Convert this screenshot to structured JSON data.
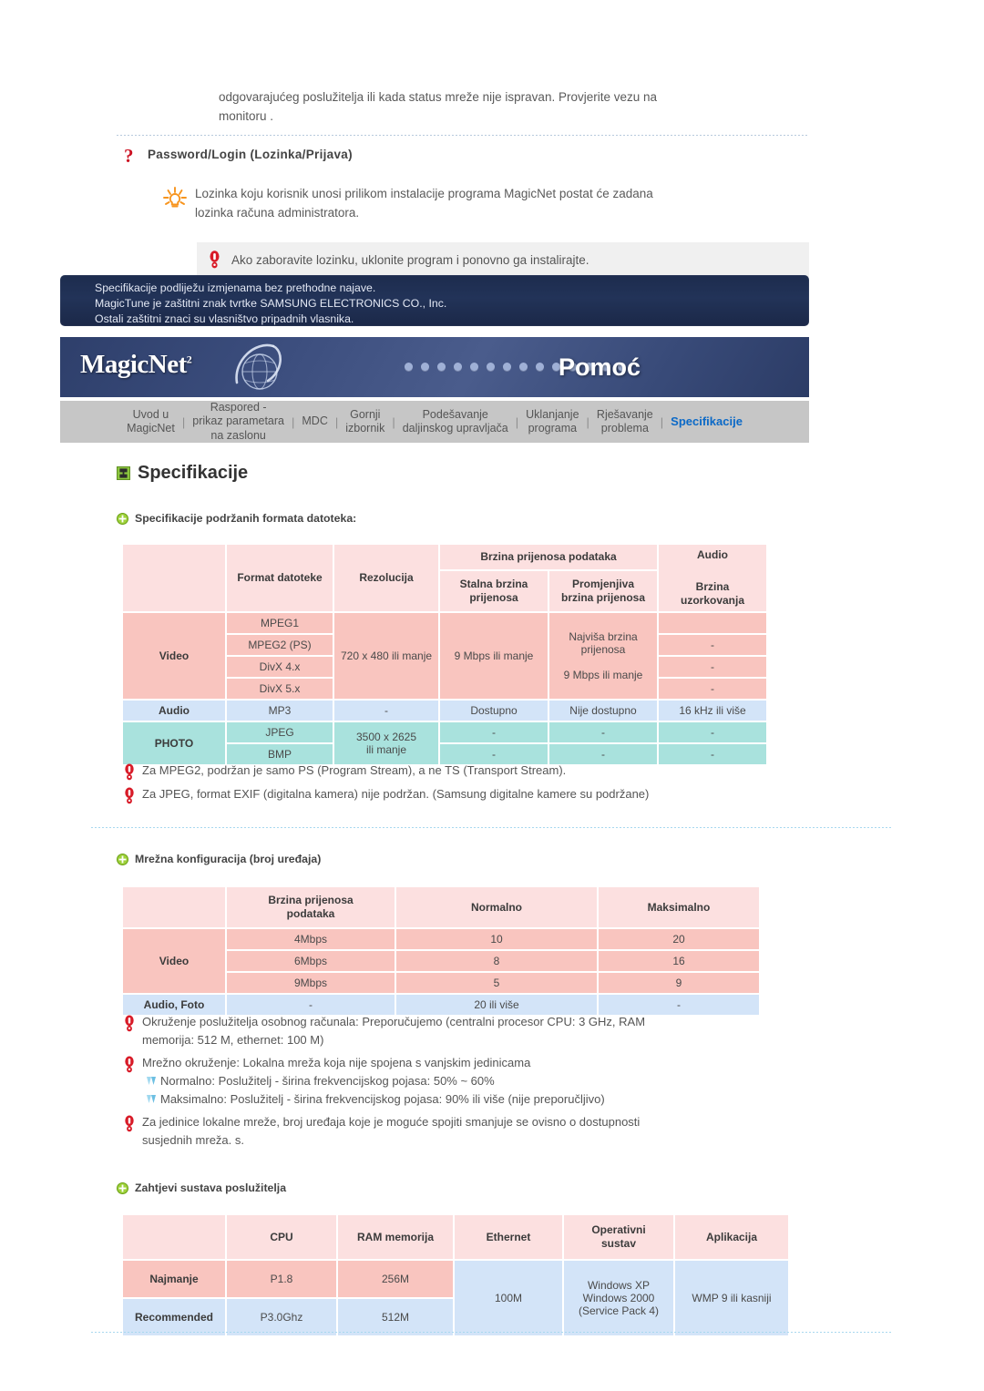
{
  "top": {
    "intro_line1": "odgovarajućeg poslužitelja ili kada status mreže nije ispravan. Provjerite vezu na",
    "intro_line2": "monitoru .",
    "question_title": "Password/Login (Lozinka/Prijava)",
    "tip_line1": "Lozinka koju korisnik unosi prilikom instalacije programa MagicNet postat će zadana",
    "tip_line2": "lozinka računa administratora.",
    "warning": "Ako zaboravite lozinku, uklonite program i ponovno ga instalirajte."
  },
  "navy_notice": {
    "line1": "Specifikacije podliježu izmjenama bez prethodne najave.",
    "line2": "MagicTune je zaštitni znak tvrtke SAMSUNG ELECTRONICS CO., Inc.",
    "line3": "Ostali zaštitni znaci su vlasništvo pripadnih vlasnika."
  },
  "header": {
    "logo": "MagicNet",
    "logo_sup": "2",
    "title": "Pomoć",
    "dot_count": 14
  },
  "nav": {
    "items": [
      {
        "label": "Uvod u\nMagicNet",
        "active": false
      },
      {
        "label": "Raspored -\nprikaz parametara\nna zaslonu",
        "active": false
      },
      {
        "label": "MDC",
        "active": false
      },
      {
        "label": "Gornji\nizbornik",
        "active": false
      },
      {
        "label": "Podešavanje\ndaljinskog upravljača",
        "active": false
      },
      {
        "label": "Uklanjanje\nprograma",
        "active": false
      },
      {
        "label": "Rješavanje\nproblema",
        "active": false
      },
      {
        "label": "Specifikacije",
        "active": true
      }
    ],
    "separator": "|"
  },
  "page_title": "Specifikacije",
  "sections": {
    "s1_heading": "Specifikacije podržanih formata datoteka:",
    "s2_heading": "Mrežna konfiguracija (broj uređaja)",
    "s3_heading": "Zahtjevi sustava poslužitelja"
  },
  "table1": {
    "h_format": "Format datoteke",
    "h_rezolucija": "Rezolucija",
    "h_brzina_group": "Brzina prijenosa podataka",
    "h_audio_group": "Audio",
    "h_stalna": "Stalna brzina\nprijenosa",
    "h_promjenjiva": "Promjenjiva\nbrzina prijenosa",
    "h_uzorkovanja": "Brzina\nuzorkovanja",
    "video_label": "Video",
    "video_formats": [
      "MPEG1",
      "MPEG2 (PS)",
      "DivX 4.x",
      "DivX 5.x"
    ],
    "video_rezolucija": "720 x 480 ili manje",
    "video_stalna": "9 Mbps ili manje",
    "video_promjenjiva_top": "Najviša brzina\nprijenosa",
    "video_promjenjiva_bottom": "9 Mbps ili manje",
    "video_uzorkovanja": [
      "",
      "-",
      "-",
      "-"
    ],
    "audio_label": "Audio",
    "audio_format": "MP3",
    "audio_rezolucija": "-",
    "audio_stalna": "Dostupno",
    "audio_promjenjiva": "Nije dostupno",
    "audio_uzorkovanja": "16 kHz ili više",
    "photo_label": "PHOTO",
    "photo_formats": [
      "JPEG",
      "BMP"
    ],
    "photo_rezolucija": "3500 x 2625\nili manje",
    "photo_dash": "-"
  },
  "notes1": [
    "Za MPEG2, podržan je samo PS (Program Stream), a ne TS (Transport Stream).",
    "Za JPEG, format EXIF (digitalna kamera) nije podržan. (Samsung digitalne kamere su podržane)"
  ],
  "table2": {
    "h_brzina": "Brzina prijenosa\npodataka",
    "h_normalno": "Normalno",
    "h_maksimalno": "Maksimalno",
    "video_label": "Video",
    "rows": [
      {
        "rate": "4Mbps",
        "normal": "10",
        "max": "20"
      },
      {
        "rate": "6Mbps",
        "normal": "8",
        "max": "16"
      },
      {
        "rate": "9Mbps",
        "normal": "5",
        "max": "9"
      }
    ],
    "audio_label": "Audio, Foto",
    "audio_rate": "-",
    "audio_normal": "20 ili više",
    "audio_max": "-"
  },
  "notes2": {
    "n1_line1": "Okruženje poslužitelja osobnog računala: Preporučujemo (centralni procesor CPU: 3 GHz, RAM",
    "n1_line2": "memorija: 512 M, ethernet: 100 M)",
    "n2_line1": "Mrežno okruženje: Lokalna mreža koja nije spojena s vanjskim jedinicama",
    "n2_sub1": "Normalno: Poslužitelj - širina frekvencijskog pojasa: 50% ~ 60%",
    "n2_sub2": "Maksimalno: Poslužitelj - širina frekvencijskog pojasa: 90% ili više (nije preporučljivo)",
    "n3_line1": "Za jedinice lokalne mreže, broj uređaja koje je moguće spojiti smanjuje se ovisno o dostupnosti",
    "n3_line2": "susjednih mreža. s."
  },
  "table3": {
    "h_cpu": "CPU",
    "h_ram": "RAM memorija",
    "h_ethernet": "Ethernet",
    "h_os": "Operativni\nsustav",
    "h_app": "Aplikacija",
    "r1_label": "Najmanje",
    "r1_cpu": "P1.8",
    "r1_ram": "256M",
    "r2_label": "Recommended",
    "r2_cpu": "P3.0Ghz",
    "r2_ram": "512M",
    "ethernet": "100M",
    "os_line1": "Windows XP",
    "os_line2": "Windows 2000",
    "os_line3": "(Service Pack 4)",
    "app": "WMP 9 ili kasniji"
  },
  "colors": {
    "accent_blue": "#0b69c7",
    "pink": "#f9c5bf",
    "pink_header": "#fce0e0",
    "blue": "#d3e4f8",
    "teal": "#a9e2dd",
    "navy": "#223358",
    "red_icon": "#cc1122",
    "green_plus": "#8cc63f"
  }
}
